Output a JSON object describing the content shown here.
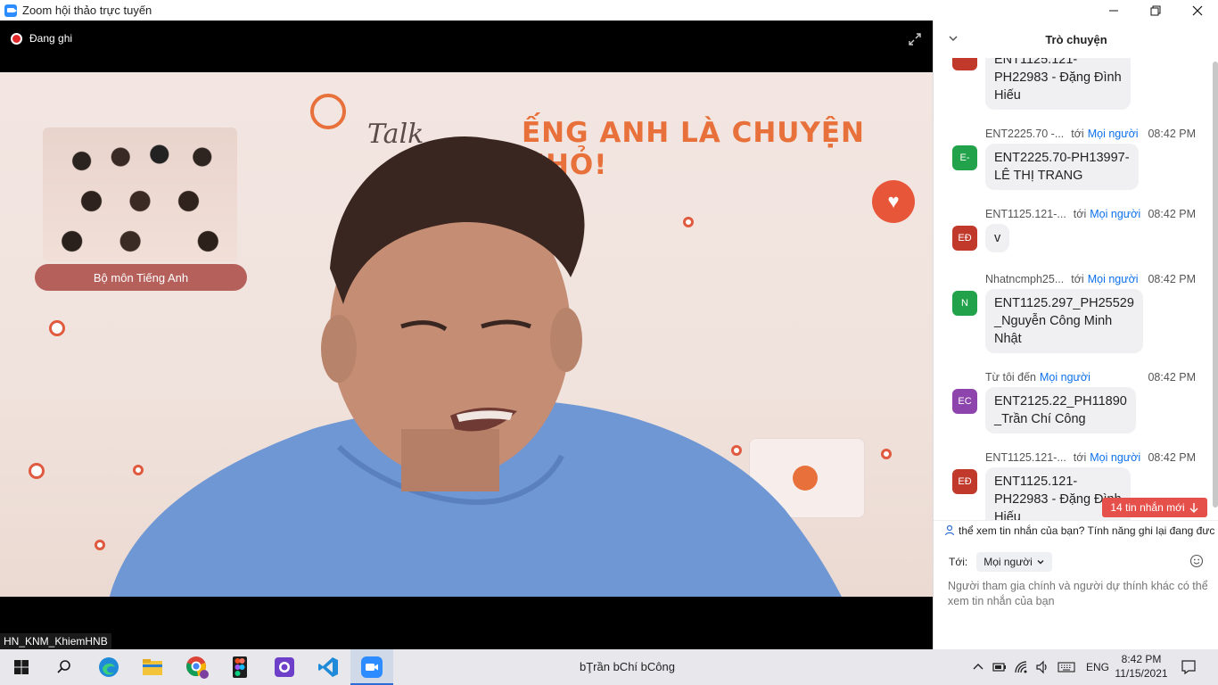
{
  "window": {
    "title": "Zoom hội thảo trực tuyến",
    "controls": [
      "minimize-icon",
      "restore-icon",
      "close-icon"
    ]
  },
  "meeting": {
    "recording_label": "Đang ghi",
    "participant_name": "HN_KNM_KhiemHNB",
    "video_banner": {
      "talk_text": "Talk",
      "title_text": "ẾNG ANH LÀ CHUYỆN NHỎ!",
      "team_label": "Bộ môn Tiếng Anh"
    }
  },
  "chat": {
    "title": "Trò chuyện",
    "to_prefix": "tới",
    "to_target": "Mọi người",
    "messages": [
      {
        "sender": "",
        "to": "",
        "time": "",
        "avatar": "",
        "avatar_color": "#c0392b",
        "text_lines": [
          "ENT1125.121-",
          "PH22983 - Đặng Đình",
          "Hiếu"
        ]
      },
      {
        "sender": "ENT2225.70 -...",
        "to": "Mọi người",
        "time": "08:42 PM",
        "avatar": "E-",
        "avatar_color": "#22a34b",
        "text_lines": [
          "ENT2225.70-PH13997-",
          "LÊ THỊ TRANG"
        ]
      },
      {
        "sender": "ENT1125.121-...",
        "to": "Mọi người",
        "time": "08:42 PM",
        "avatar": "EĐ",
        "avatar_color": "#c0392b",
        "text_lines": [
          "v"
        ]
      },
      {
        "sender": "Nhatncmph25...",
        "to": "Mọi người",
        "time": "08:42 PM",
        "avatar": "N",
        "avatar_color": "#22a34b",
        "text_lines": [
          "ENT1125.297_PH25529",
          "_Nguyễn Công Minh",
          "Nhật"
        ]
      },
      {
        "sender": "Từ tôi đến",
        "to": "Mọi người",
        "time": "08:42 PM",
        "avatar": "EC",
        "avatar_color": "#8e44ad",
        "self": true,
        "text_lines": [
          "ENT2125.22_PH11890",
          "_Trần Chí Công"
        ]
      },
      {
        "sender": "ENT1125.121-...",
        "to": "Mọi người",
        "time": "08:42 PM",
        "avatar": "EĐ",
        "avatar_color": "#c0392b",
        "text_lines": [
          "ENT1125.121-",
          "PH22983 - Đặng Đình",
          "Hiếu"
        ]
      }
    ],
    "new_messages_badge": "14 tin nhắn mới",
    "notice": "thể xem tin nhắn của bạn? Tính năng ghi lại đang đưc",
    "to_label": "Tới:",
    "to_select_value": "Mọi người",
    "input_placeholder": "Người tham gia chính và người dự thính khác có thể xem tin nhắn của bạn"
  },
  "taskbar": {
    "apps": [
      "start-icon",
      "search-icon",
      "edge-icon",
      "file-explorer-icon",
      "chrome-icon",
      "figma-icon",
      "github-desktop-icon",
      "vscode-icon",
      "zoom-icon"
    ],
    "center_text": "bŢrần bChí bCông",
    "language": "ENG",
    "time": "8:42 PM",
    "date": "11/15/2021"
  }
}
